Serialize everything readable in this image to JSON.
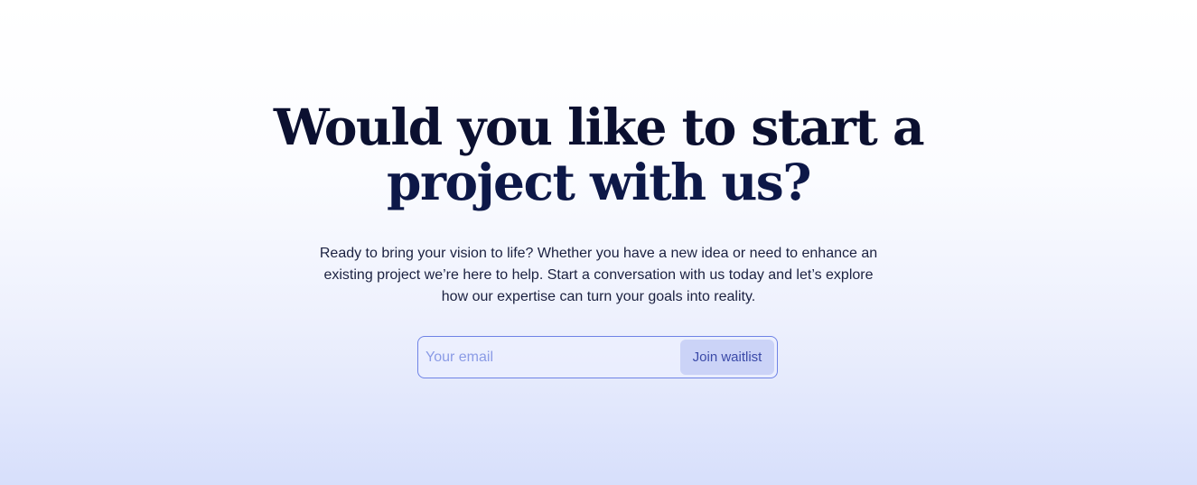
{
  "headline": {
    "line1": "Would you like to start a",
    "line2": "project with us?"
  },
  "subtext": "Ready to bring your vision to life? Whether you have a new idea or need to enhance an existing project we’re here to help. Start a conversation with us today and let’s explore how our expertise can turn your goals into reality.",
  "form": {
    "email_placeholder": "Your email",
    "email_value": "",
    "submit_label": "Join waitlist"
  },
  "colors": {
    "headline": "#0b1030",
    "accent_border": "#6f83e6",
    "button_bg": "#cbd3f7",
    "button_text": "#3b4aa8",
    "placeholder": "#8a9be6",
    "gradient_bottom": "#d7dffb"
  }
}
